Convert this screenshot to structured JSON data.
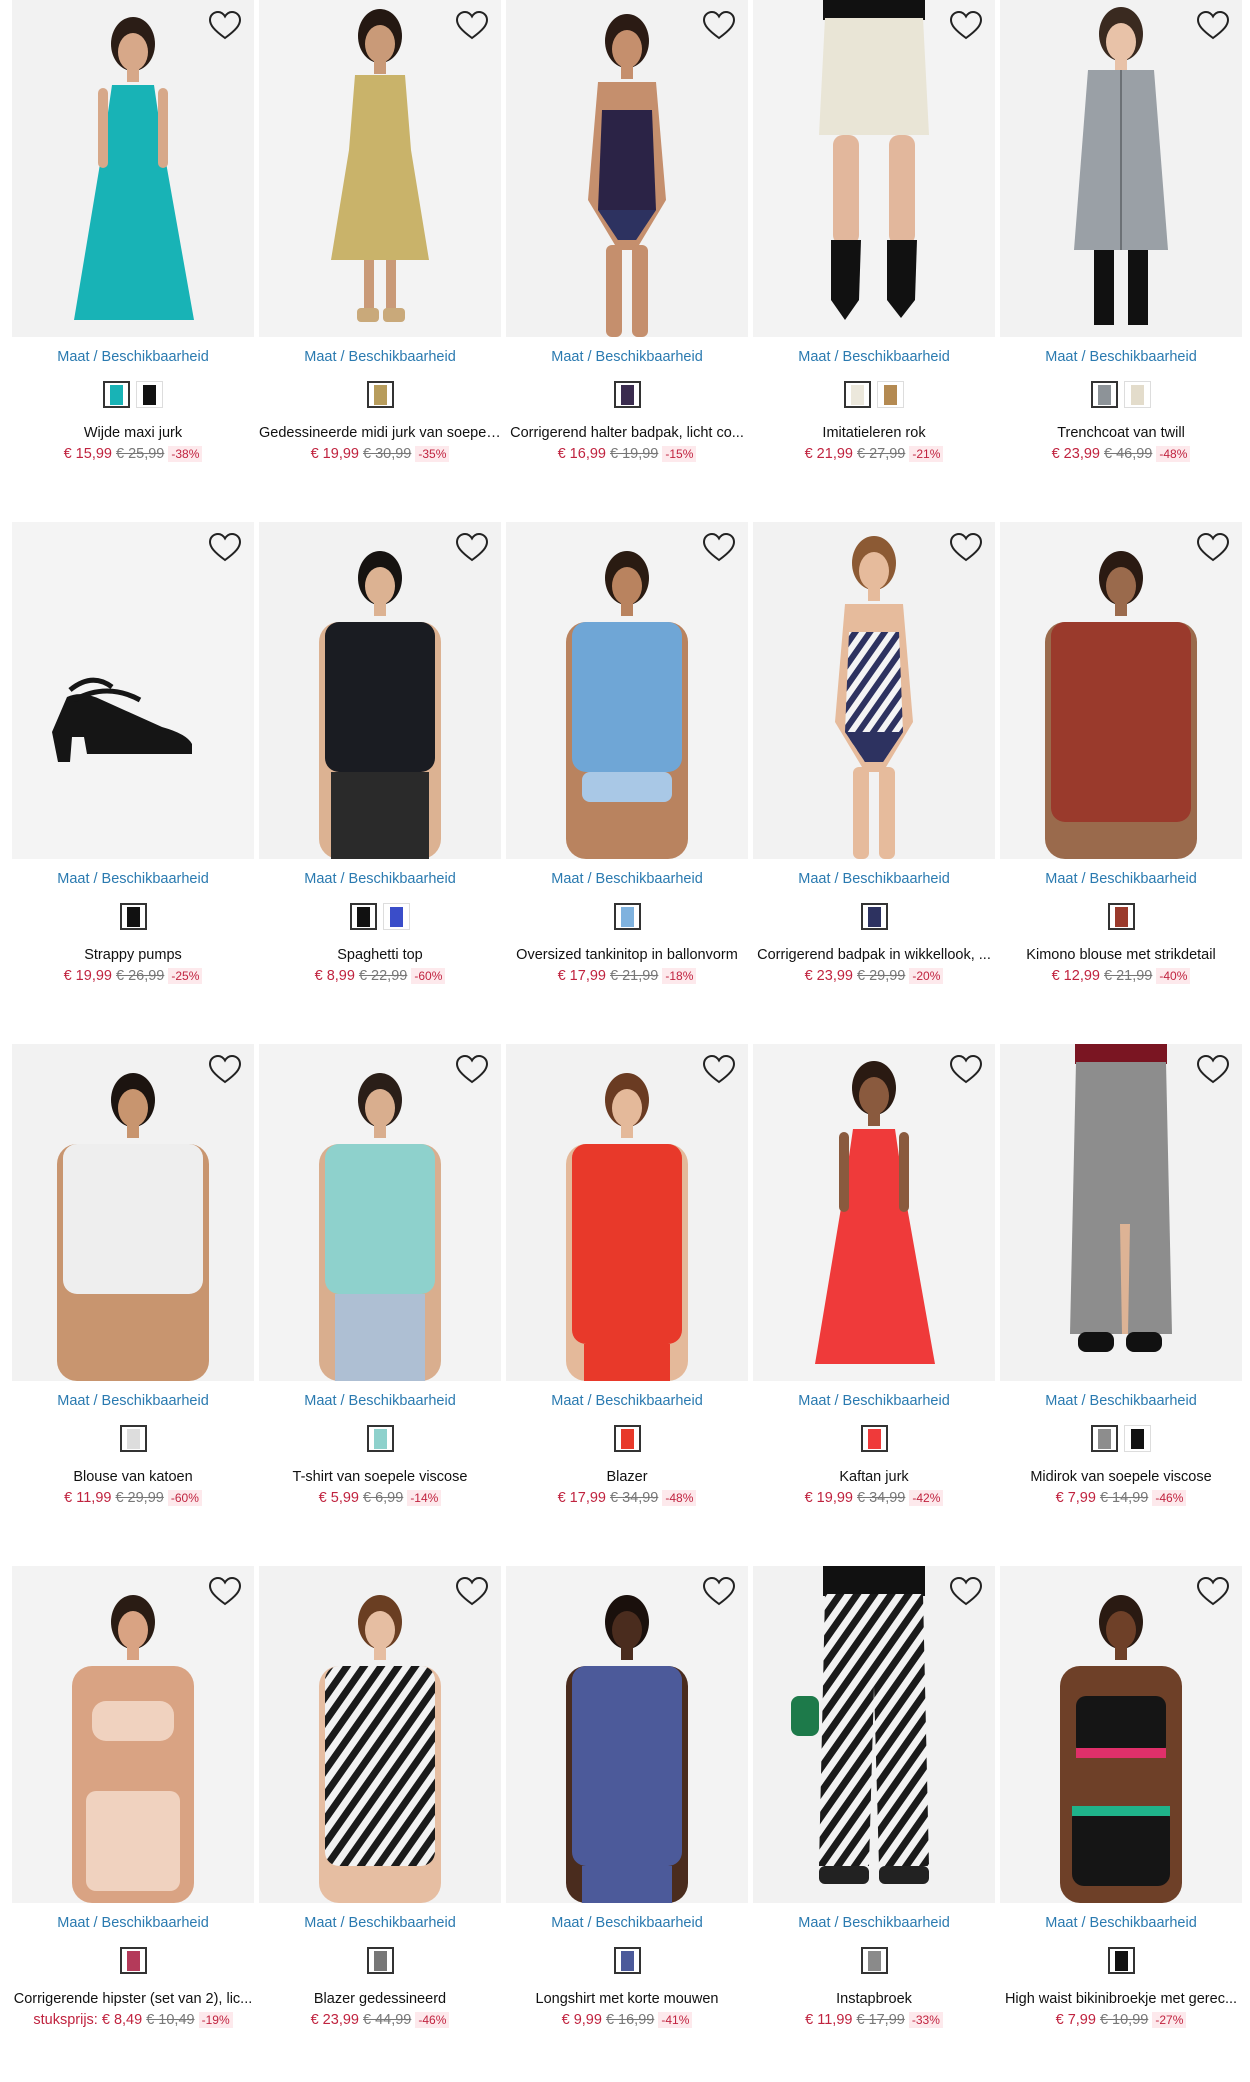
{
  "common": {
    "size_link": "Maat / Beschikbaarheid"
  },
  "colors": {
    "link": "#2a7ab0",
    "sale": "#c0233f",
    "old_price": "#777777"
  },
  "products": [
    {
      "title": "Wijde maxi jurk",
      "price": "€ 15,99",
      "old_price": "€ 25,99",
      "discount": "-38%",
      "bg": "#f2f2f2",
      "garment": "#18b3b6",
      "skin": "#d7a889",
      "hair": "#2b1d16",
      "shape": "dress-long",
      "swatches": [
        "#18b3b6",
        "#111111"
      ]
    },
    {
      "title": "Gedessineerde midi jurk van soepel...",
      "price": "€ 19,99",
      "old_price": "€ 30,99",
      "discount": "-35%",
      "bg": "#f3f3f3",
      "garment": "#c9b36a",
      "skin": "#c99a78",
      "hair": "#241812",
      "shape": "dress-midi",
      "swatches": [
        "#b79c5c"
      ]
    },
    {
      "title": "Corrigerend halter badpak, licht co...",
      "price": "€ 16,99",
      "old_price": "€ 19,99",
      "discount": "-15%",
      "bg": "#f2f2f2",
      "garment": "#2b2346",
      "skin": "#c58f6d",
      "hair": "#2b1b14",
      "shape": "swim",
      "swatches": [
        "#3a2b4e"
      ]
    },
    {
      "title": "Imitatieleren rok",
      "price": "€ 21,99",
      "old_price": "€ 27,99",
      "discount": "-21%",
      "bg": "#f3f3f3",
      "garment": "#e9e5d6",
      "skin": "#e2b79c",
      "hair": "#222222",
      "shape": "skirt",
      "swatches": [
        "#ece8dc",
        "#b48a52"
      ]
    },
    {
      "title": "Trenchcoat van twill",
      "price": "€ 23,99",
      "old_price": "€ 46,99",
      "discount": "-48%",
      "bg": "#f2f2f2",
      "garment": "#9aa0a6",
      "skin": "#e8c2a8",
      "hair": "#3a2a20",
      "shape": "coat",
      "swatches": [
        "#8d9398",
        "#e3dccb"
      ]
    },
    {
      "title": "Strappy pumps",
      "price": "€ 19,99",
      "old_price": "€ 26,99",
      "discount": "-25%",
      "bg": "#f4f4f4",
      "garment": "#151515",
      "skin": "#f4f4f4",
      "hair": "#f4f4f4",
      "shape": "shoe",
      "swatches": [
        "#111111"
      ]
    },
    {
      "title": "Spaghetti top",
      "price": "€ 8,99",
      "old_price": "€ 22,99",
      "discount": "-60%",
      "bg": "#f2f2f2",
      "garment": "#1a1c22",
      "skin": "#dcb292",
      "hair": "#161311",
      "shape": "top",
      "swatches": [
        "#111111",
        "#3a4dc9"
      ]
    },
    {
      "title": "Oversized tankinitop in ballonvorm",
      "price": "€ 17,99",
      "old_price": "€ 21,99",
      "discount": "-18%",
      "bg": "#f3f3f3",
      "garment": "#6fa6d6",
      "skin": "#b9835f",
      "hair": "#2a1b12",
      "shape": "tankini",
      "swatches": [
        "#7fb2de"
      ]
    },
    {
      "title": "Corrigerend badpak in wikkellook, ...",
      "price": "€ 23,99",
      "old_price": "€ 29,99",
      "discount": "-20%",
      "bg": "#f2f2f2",
      "garment": "#2d3260",
      "skin": "#e6bb9c",
      "hair": "#8c5a34",
      "shape": "swim-stripe",
      "swatches": [
        "#2d3260"
      ]
    },
    {
      "title": "Kimono blouse met strikdetail",
      "price": "€ 12,99",
      "old_price": "€ 21,99",
      "discount": "-40%",
      "bg": "#f3f3f3",
      "garment": "#9a3a2c",
      "skin": "#9a6a4c",
      "hair": "#2a1a12",
      "shape": "kimono",
      "swatches": [
        "#9a3a2c"
      ]
    },
    {
      "title": "Blouse van katoen",
      "price": "€ 11,99",
      "old_price": "€ 29,99",
      "discount": "-60%",
      "bg": "#f2f2f2",
      "garment": "#eeeeee",
      "skin": "#c8956f",
      "hair": "#1c1410",
      "shape": "blouse",
      "swatches": [
        "#dddddd"
      ]
    },
    {
      "title": "T-shirt van soepele viscose",
      "price": "€ 5,99",
      "old_price": "€ 6,99",
      "discount": "-14%",
      "bg": "#f3f3f3",
      "garment": "#8ed1cc",
      "skin": "#d9ae8e",
      "hair": "#2a1e18",
      "shape": "tshirt",
      "swatches": [
        "#8ed1cc"
      ]
    },
    {
      "title": "Blazer",
      "price": "€ 17,99",
      "old_price": "€ 34,99",
      "discount": "-48%",
      "bg": "#f2f2f2",
      "garment": "#e8392a",
      "skin": "#e4b99a",
      "hair": "#6a3b22",
      "shape": "blazer",
      "swatches": [
        "#e8392a"
      ]
    },
    {
      "title": "Kaftan jurk",
      "price": "€ 19,99",
      "old_price": "€ 34,99",
      "discount": "-42%",
      "bg": "#f3f3f3",
      "garment": "#ef3a3a",
      "skin": "#8a5a3e",
      "hair": "#2a1a12",
      "shape": "dress-long",
      "swatches": [
        "#ef3a3a"
      ]
    },
    {
      "title": "Midirok van soepele viscose",
      "price": "€ 7,99",
      "old_price": "€ 14,99",
      "discount": "-46%",
      "bg": "#f2f2f2",
      "garment": "#8d8d8d",
      "skin": "#ddb395",
      "hair": "#7a1522",
      "shape": "skirt-long",
      "swatches": [
        "#8d8d8d",
        "#111111"
      ]
    },
    {
      "title": "Corrigerende hipster (set van 2), lic...",
      "unit_label": "stuksprijs:",
      "price": "€ 8,49",
      "old_price": "€ 10,49",
      "discount": "-19%",
      "bg": "#f3f3f3",
      "garment": "#f0d2bf",
      "skin": "#d9a383",
      "hair": "#2a1c14",
      "shape": "lingerie",
      "swatches": [
        "#b43a5a"
      ]
    },
    {
      "title": "Blazer gedessineerd",
      "price": "€ 23,99",
      "old_price": "€ 44,99",
      "discount": "-46%",
      "bg": "#f2f2f2",
      "garment": "#efefef",
      "skin": "#e6bea2",
      "hair": "#6a3e22",
      "shape": "blazer-zebra",
      "swatches": [
        "#777777"
      ]
    },
    {
      "title": "Longshirt met korte mouwen",
      "price": "€ 9,99",
      "old_price": "€ 16,99",
      "discount": "-41%",
      "bg": "#f3f3f3",
      "garment": "#4c5a9a",
      "skin": "#4a2c1e",
      "hair": "#1a100c",
      "shape": "longshirt",
      "swatches": [
        "#4c5a9a"
      ]
    },
    {
      "title": "Instapbroek",
      "price": "€ 11,99",
      "old_price": "€ 17,99",
      "discount": "-33%",
      "bg": "#f2f2f2",
      "garment": "#efefef",
      "skin": "#e3b596",
      "hair": "#222222",
      "shape": "pants-zebra",
      "swatches": [
        "#8a8a8a"
      ]
    },
    {
      "title": "High waist bikinibroekje met gerec...",
      "price": "€ 7,99",
      "old_price": "€ 10,99",
      "discount": "-27%",
      "bg": "#f3f3f3",
      "garment": "#151515",
      "skin": "#6e4028",
      "hair": "#2a1a12",
      "shape": "bikini",
      "swatches": [
        "#111111"
      ]
    }
  ]
}
